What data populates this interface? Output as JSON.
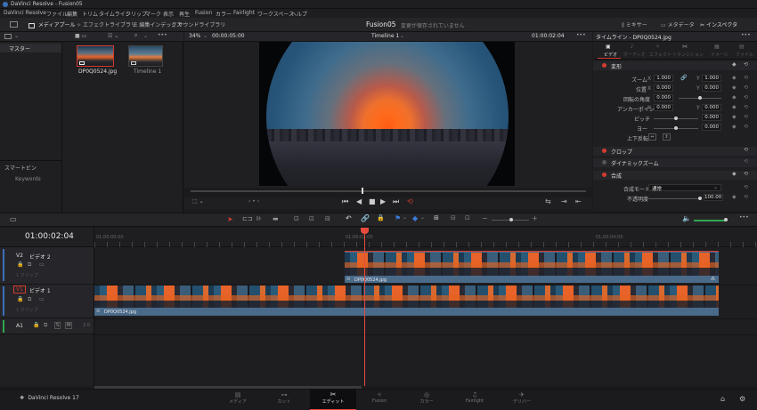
{
  "titlebar": {
    "app_title": "DaVinci Resolve - Fusion05"
  },
  "menu": [
    "DaVinci Resolve",
    "ファイル",
    "編集",
    "トリム",
    "タイムライン",
    "クリップ",
    "マーク",
    "表示",
    "再生",
    "Fusion",
    "カラー",
    "Fairlight",
    "ワークスペース",
    "ヘルプ"
  ],
  "toolbar": {
    "media_pool": "メディアプール",
    "effects_library": "エフェクトライブラリ",
    "edit_index": "編集インデックス",
    "sound_library": "サウンドライブラリ",
    "project_title": "Fusion05",
    "unsaved": "変更が保存されていません",
    "mixer": "ミキサー",
    "metadata": "メタデータ",
    "inspector": "インスペクタ"
  },
  "media": {
    "bin_master": "マスター",
    "smart_bins": "スマートビン",
    "keywords": "Keywords",
    "clips": [
      {
        "name": "DP0Q0524.jpg"
      },
      {
        "name": "Timeline 1"
      }
    ]
  },
  "viewer": {
    "zoom": "34%",
    "source_tc": "00:00:05:00",
    "timeline_name": "Timeline 1",
    "record_tc": "01:00:02:04"
  },
  "inspector": {
    "title": "タイムライン - DP0Q0524.jpg",
    "tabs": [
      "ビデオ",
      "オーディオ",
      "エフェクト",
      "トランジション",
      "イメージ",
      "ファイル"
    ],
    "transform": "変形",
    "zoom_label": "ズーム",
    "zoom_x": "1.000",
    "zoom_y": "1.000",
    "position_label": "位置",
    "pos_x": "0.000",
    "pos_y": "0.000",
    "rotation_label": "回転の角度",
    "rotation": "0.000",
    "anchor_label": "アンカーポイント",
    "anchor_x": "0.000",
    "anchor_y": "0.000",
    "pitch_label": "ピッチ",
    "pitch": "0.000",
    "yaw_label": "ヨー",
    "yaw": "0.000",
    "flip_label": "上下反転",
    "crop": "クロップ",
    "dynamic_zoom": "ダイナミックズーム",
    "composite": "合成",
    "comp_mode_label": "合成モード",
    "comp_mode": "通常",
    "opacity_label": "不透明度",
    "opacity": "100.00",
    "x_lbl": "X",
    "y_lbl": "Y"
  },
  "timeline": {
    "timecode": "01:00:02:04",
    "ruler": [
      "01:00:00:00",
      "01:00:02:00",
      "01:00:04:00"
    ],
    "v2": {
      "id": "V2",
      "name": "ビデオ 2",
      "clips": "1 クリップ"
    },
    "v1": {
      "id": "V1",
      "name": "ビデオ 1",
      "clips": "1 クリップ"
    },
    "a1": {
      "id": "A1",
      "ch": "2.0",
      "s": "S",
      "m": "M"
    },
    "clip_v2": "DP0Q0524.jpg",
    "clip_v1": "DP0Q0524.jpg"
  },
  "pages": [
    "メディア",
    "カット",
    "エディット",
    "Fusion",
    "カラー",
    "Fairlight",
    "デリバー"
  ],
  "brand": "DaVinci Resolve 17",
  "colors": {
    "accent": "#d23b2f",
    "clip": "#4a6a8a",
    "active_page": "#e64b3c"
  }
}
